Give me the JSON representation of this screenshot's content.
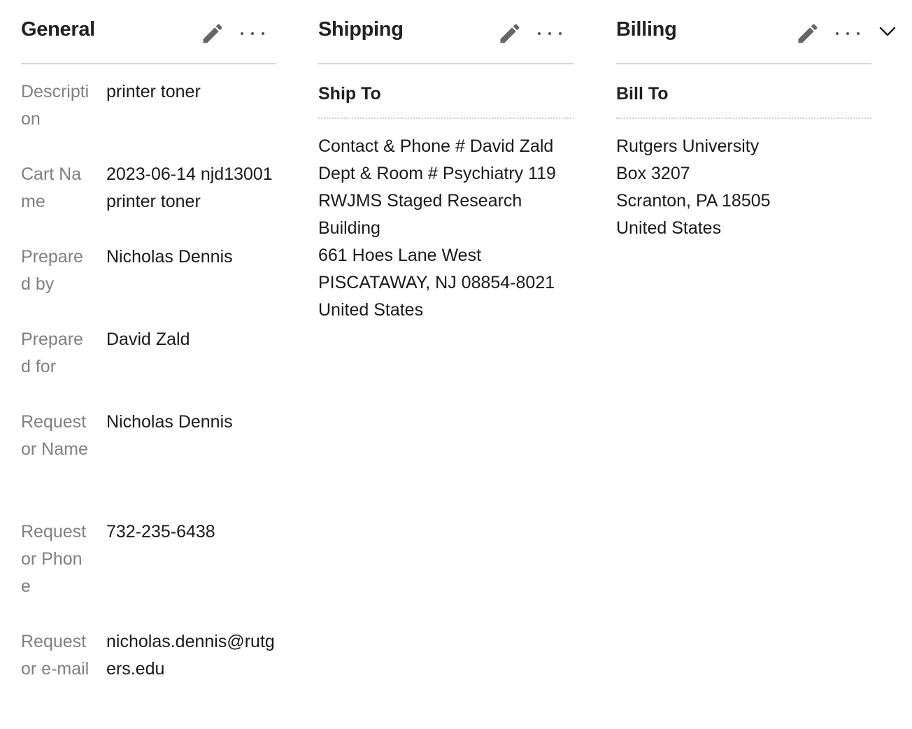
{
  "general": {
    "title": "General",
    "fields": [
      {
        "label": "Description",
        "value": "printer toner"
      },
      {
        "label": "Cart Name",
        "value": "2023-06-14 njd13001 printer toner"
      },
      {
        "label": "Prepared by",
        "value": "Nicholas Dennis"
      },
      {
        "label": "Prepared for",
        "value": "David Zald"
      },
      {
        "label": "Requestor Name",
        "value": "Nicholas Dennis"
      },
      {
        "label": "Requestor Phone",
        "value": "732-235-6438"
      },
      {
        "label": "Requestor e-mail",
        "value": "nicholas.dennis@rutgers.edu"
      }
    ]
  },
  "shipping": {
    "title": "Shipping",
    "subtitle": "Ship To",
    "lines": [
      "Contact & Phone # David Zald",
      "Dept & Room # Psychiatry 119",
      "RWJMS Staged Research Building",
      "661 Hoes Lane West",
      "PISCATAWAY, NJ 08854-8021",
      "United States"
    ]
  },
  "billing": {
    "title": "Billing",
    "subtitle": "Bill To",
    "lines": [
      "Rutgers University",
      "Box 3207",
      "Scranton, PA 18505",
      "United States"
    ]
  },
  "icons": {
    "edit": "pencil-icon",
    "more": "more-horizontal-icon",
    "collapse": "chevron-down-icon"
  },
  "colors": {
    "label": "#808080",
    "text": "#1a1a1a",
    "icon": "#666666",
    "divider": "#d9d9d9"
  }
}
